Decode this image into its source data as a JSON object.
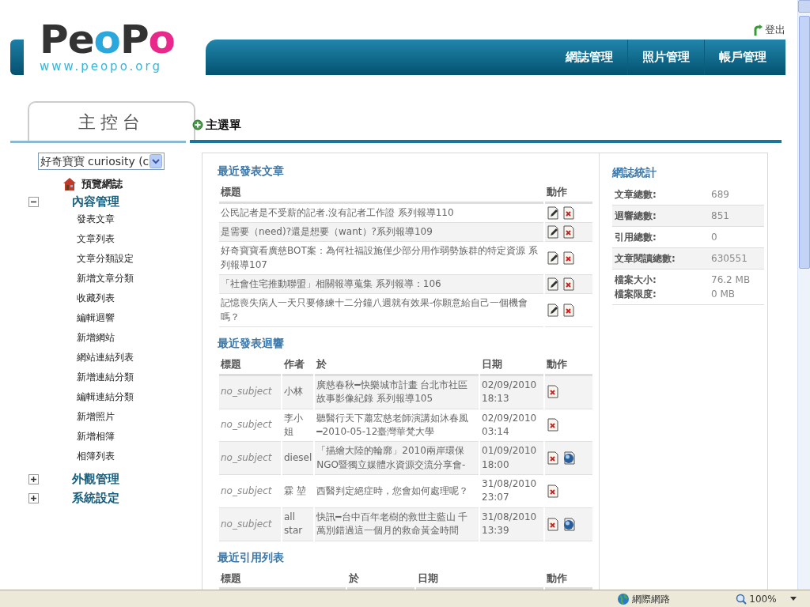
{
  "header": {
    "logo": "PeoPo",
    "logo_url": "www.peopo.org",
    "logout": "登出",
    "nav": [
      {
        "label": "網誌管理"
      },
      {
        "label": "照片管理"
      },
      {
        "label": "帳戶管理"
      }
    ]
  },
  "sidebar": {
    "title": "主控台",
    "blog_select": {
      "value": "好奇寶寶 curiosity (c"
    },
    "preview": "預覽網誌",
    "sections": [
      {
        "label": "內容管理",
        "expanded": true,
        "items": [
          "發表文章",
          "文章列表",
          "文章分類設定",
          "新增文章分類",
          "收藏列表",
          "編輯迴響",
          "新增網站",
          "網站連結列表",
          "新增連結分類",
          "編輯連結分類",
          "新增照片",
          "新增相簿",
          "相簿列表"
        ]
      },
      {
        "label": "外觀管理",
        "expanded": false
      },
      {
        "label": "系統設定",
        "expanded": false
      }
    ]
  },
  "main": {
    "heading": "主選單",
    "recent_posts": {
      "title": "最近發表文章",
      "columns": [
        "標題",
        "動作"
      ],
      "rows": [
        {
          "title": "公民記者是不受薪的記者.沒有記者工作證 系列報導110",
          "can_edit": true,
          "can_delete": true
        },
        {
          "title": "是需要（need)?還是想要（want）?系列報導109",
          "can_edit": true,
          "can_delete": true
        },
        {
          "title": "好奇寶寶看廣慈BOT案：為何社福設施僅少部分用作弱勢族群的特定資源 系列報導107",
          "can_edit": true,
          "can_delete": true
        },
        {
          "title": "「社會住宅推動聯盟」相關報導蒐集 系列報導：106",
          "can_edit": true,
          "can_delete": true
        },
        {
          "title": "記憶喪失病人一天只要修練十二分鐘八週就有效果-你願意給自己一個機會嗎？",
          "can_edit": true,
          "can_delete": true
        }
      ]
    },
    "recent_comments": {
      "title": "最近發表迴響",
      "columns": [
        "標題",
        "作者",
        "於",
        "日期",
        "動作"
      ],
      "rows": [
        {
          "title": "no_subject",
          "author": "小林",
          "on": "廣慈春秋━快樂城市計畫 台北市社區故事影像紀錄 系列報導105",
          "date": "02/09/2010 18:13",
          "can_delete": true,
          "can_view": false
        },
        {
          "title": "no_subject",
          "author": "李小姐",
          "on": "聽醫行天下蕭宏慈老師演講如沐春風━2010-05-12臺灣華梵大學",
          "date": "02/09/2010 03:14",
          "can_delete": true,
          "can_view": false
        },
        {
          "title": "no_subject",
          "author": "diesel",
          "on": "「描繪大陸的輪廓」2010兩岸環保NGO暨獨立媒體水資源交流分享會-",
          "date": "01/09/2010 18:00",
          "can_delete": true,
          "can_view": true
        },
        {
          "title": "no_subject",
          "author": "霖 堃",
          "on": "西醫判定絕症時，您會如何處理呢？",
          "date": "31/08/2010 23:07",
          "can_delete": true,
          "can_view": false
        },
        {
          "title": "no_subject",
          "author": "all star",
          "on": "快訊━台中百年老樹的救世主藍山 千萬別錯過這一個月的救命黃金時間",
          "date": "31/08/2010 13:39",
          "can_delete": true,
          "can_view": true
        }
      ]
    },
    "recent_trackbacks": {
      "title": "最近引用列表",
      "columns": [
        "標題",
        "於",
        "日期",
        "動作"
      ]
    },
    "stats": {
      "title": "網誌統計",
      "rows": [
        {
          "labels": [
            "文章總數:"
          ],
          "values": [
            "689"
          ]
        },
        {
          "labels": [
            "迴響總數:"
          ],
          "values": [
            "851"
          ]
        },
        {
          "labels": [
            "引用總數:"
          ],
          "values": [
            "0"
          ]
        },
        {
          "labels": [
            "文章閱讀總數:"
          ],
          "values": [
            "630551"
          ]
        },
        {
          "labels": [
            "檔案大小:",
            "檔案限度:"
          ],
          "values": [
            "76.2 MB",
            "0 MB"
          ]
        }
      ]
    }
  },
  "status_bar": {
    "zone": "網際網路",
    "zoom": "100%"
  }
}
